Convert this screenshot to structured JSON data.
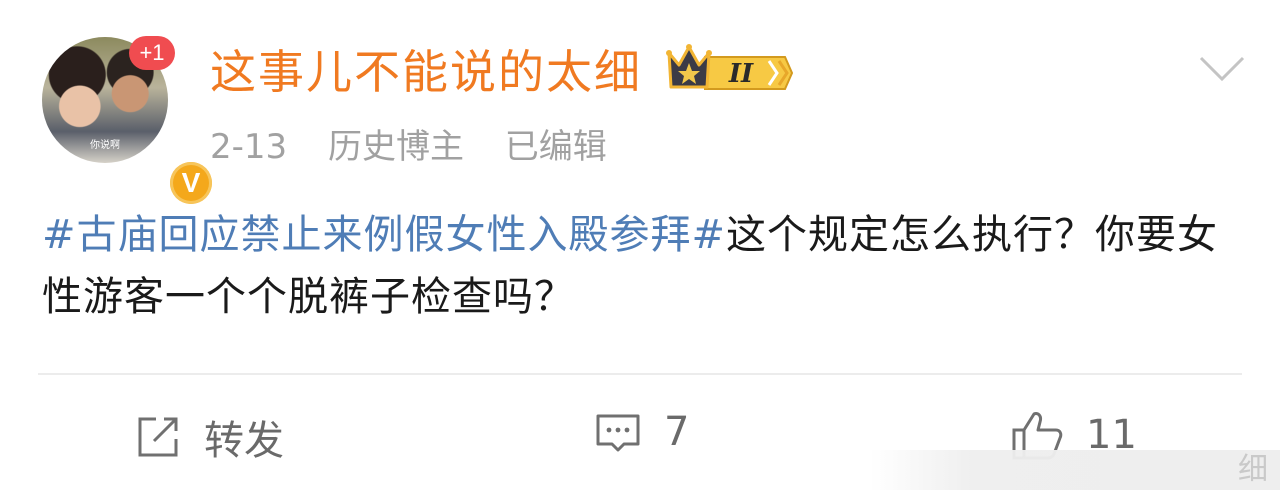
{
  "post": {
    "user": {
      "name": "这事儿不能说的太细",
      "notification_count": "+1",
      "verified_label": "V",
      "level_label": "II",
      "avatar_caption": "你说啊"
    },
    "meta": {
      "date": "2-13",
      "category": "历史博主",
      "edited": "已编辑"
    },
    "content": {
      "topic": "#古庙回应禁止来例假女性入殿参拜#",
      "text": "这个规定怎么执行？你要女性游客一个个脱裤子检查吗？"
    },
    "actions": {
      "repost_label": "转发",
      "comment_count": "7",
      "like_count": "11"
    },
    "watermark": "细"
  },
  "colors": {
    "username": "#f07a21",
    "topic": "#4f7db6",
    "meta": "#a1a1a1",
    "badge_red": "#f04c50",
    "verified_gold": "#f4a81b"
  },
  "icons": [
    "chevron-down-icon",
    "crown-level-icon",
    "repost-icon",
    "comment-icon",
    "like-icon"
  ]
}
